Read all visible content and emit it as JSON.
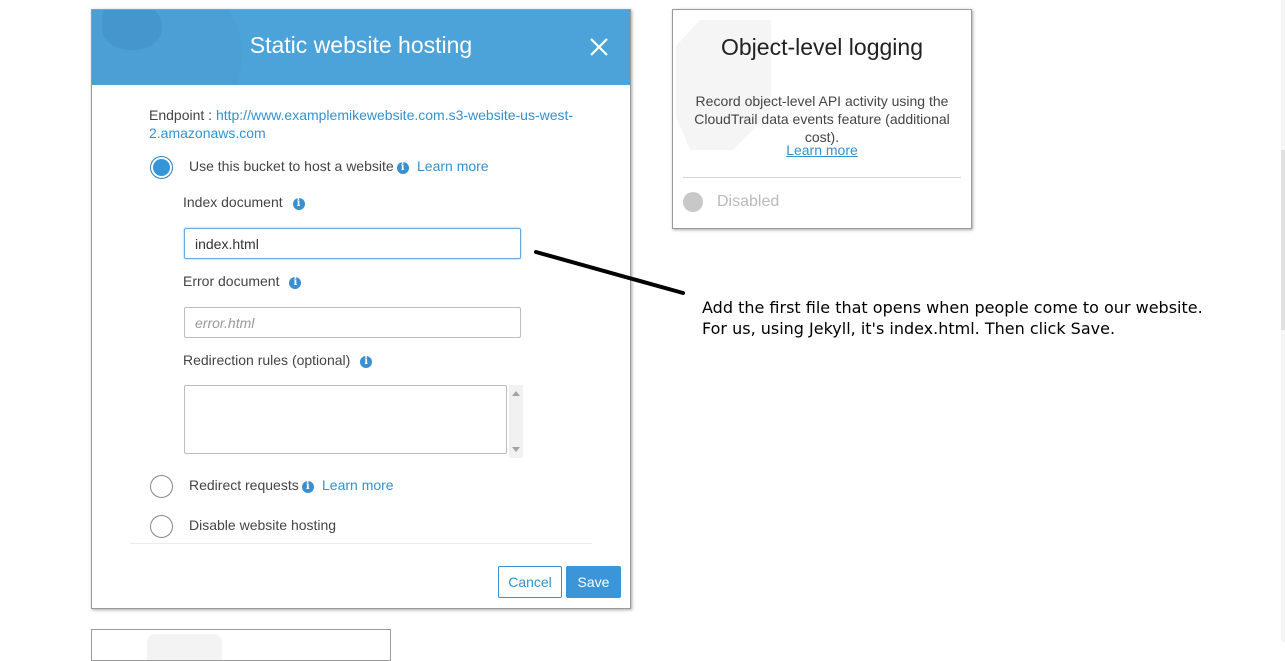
{
  "modal": {
    "title": "Static website hosting",
    "endpoint_label": "Endpoint : ",
    "endpoint_url": "http://www.examplemikewebsite.com.s3-website-us-west-2.amazonaws.com",
    "options": [
      {
        "label": "Use this bucket to host a website",
        "learn_more": "Learn more",
        "selected": true
      },
      {
        "label": "Redirect requests",
        "learn_more": "Learn more",
        "selected": false
      },
      {
        "label": "Disable website hosting",
        "selected": false
      }
    ],
    "fields": {
      "index_label": "Index document",
      "index_value": "index.html",
      "error_label": "Error document",
      "error_placeholder": "error.html",
      "redirection_label": "Redirection rules (optional)"
    },
    "cancel_label": "Cancel",
    "save_label": "Save",
    "info_glyph": "i"
  },
  "logging_card": {
    "title": "Object-level logging",
    "description": "Record object-level API activity using the CloudTrail data events feature (additional cost).",
    "learn_more": "Learn more",
    "status": "Disabled"
  },
  "annotation": {
    "line1": "Add the first file that opens when people come to our website.",
    "line2": "For us, using Jekyll, it's index.html. Then click Save."
  },
  "colors": {
    "header_blue": "#4ca3d9",
    "link_blue": "#3392d1",
    "save_button": "#3a96d9"
  },
  "icons": {
    "close": "close-icon",
    "info": "info-icon"
  }
}
